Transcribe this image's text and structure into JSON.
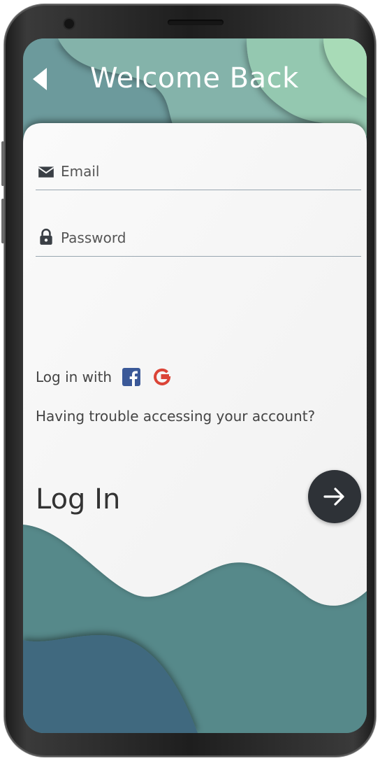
{
  "header": {
    "title": "Welcome Back",
    "back_icon": "back-arrow-icon"
  },
  "form": {
    "email": {
      "placeholder": "Email",
      "value": "",
      "icon": "mail-icon"
    },
    "password": {
      "placeholder": "Password",
      "value": "",
      "icon": "lock-icon"
    }
  },
  "social": {
    "label": "Log in with",
    "providers": [
      {
        "name": "facebook",
        "icon": "facebook-icon",
        "color": "#3b5998"
      },
      {
        "name": "google",
        "icon": "google-icon",
        "color": "#db4437"
      }
    ]
  },
  "trouble_link": "Having trouble accessing your account?",
  "login": {
    "label": "Log In",
    "button_icon": "arrow-right-icon"
  },
  "colors": {
    "card": "#f8f8f8",
    "wave_teal": "#56898a",
    "wave_dark": "#3f6b80",
    "accent_green": "#a8dbb7",
    "button": "#2e3237"
  }
}
